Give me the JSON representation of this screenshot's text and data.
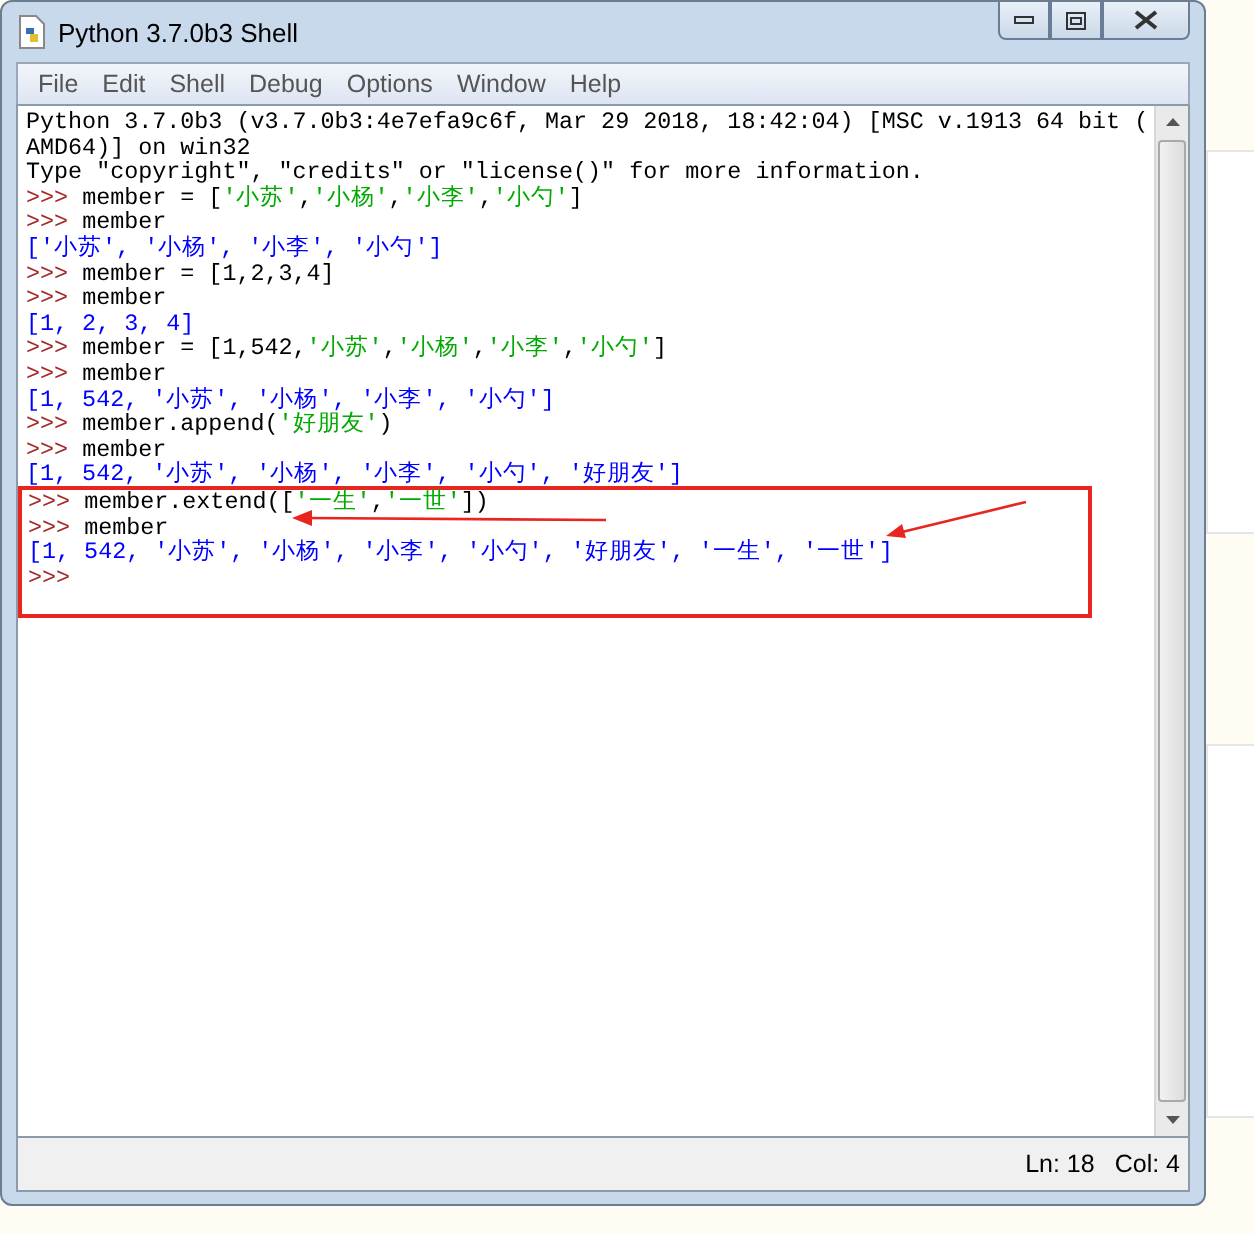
{
  "window": {
    "title": "Python 3.7.0b3 Shell"
  },
  "menu": [
    "File",
    "Edit",
    "Shell",
    "Debug",
    "Options",
    "Window",
    "Help"
  ],
  "lines": [
    {
      "boxed": false,
      "segments": [
        {
          "kind": "output_plain",
          "text": "Python 3.7.0b3 (v3.7.0b3:4e7efa9c6f, Mar 29 2018, 18:42:04) [MSC v.1913 64 bit ("
        }
      ]
    },
    {
      "boxed": false,
      "segments": [
        {
          "kind": "output_plain",
          "text": "AMD64)] on win32"
        }
      ]
    },
    {
      "boxed": false,
      "segments": [
        {
          "kind": "output_plain",
          "text": "Type \"copyright\", \"credits\" or \"license()\" for more information."
        }
      ]
    },
    {
      "boxed": false,
      "segments": [
        {
          "kind": "prompt",
          "text": ">>> "
        },
        {
          "kind": "code",
          "text": "member = ["
        },
        {
          "kind": "string",
          "text": "'小苏'"
        },
        {
          "kind": "code",
          "text": ","
        },
        {
          "kind": "string",
          "text": "'小杨'"
        },
        {
          "kind": "code",
          "text": ","
        },
        {
          "kind": "string",
          "text": "'小李'"
        },
        {
          "kind": "code",
          "text": ","
        },
        {
          "kind": "string",
          "text": "'小勺'"
        },
        {
          "kind": "code",
          "text": "]"
        }
      ]
    },
    {
      "boxed": false,
      "segments": [
        {
          "kind": "prompt",
          "text": ">>> "
        },
        {
          "kind": "code",
          "text": "member"
        }
      ]
    },
    {
      "boxed": false,
      "segments": [
        {
          "kind": "result",
          "text": "['小苏', '小杨', '小李', '小勺']"
        }
      ]
    },
    {
      "boxed": false,
      "segments": [
        {
          "kind": "prompt",
          "text": ">>> "
        },
        {
          "kind": "code",
          "text": "member = [1,2,3,4]"
        }
      ]
    },
    {
      "boxed": false,
      "segments": [
        {
          "kind": "prompt",
          "text": ">>> "
        },
        {
          "kind": "code",
          "text": "member"
        }
      ]
    },
    {
      "boxed": false,
      "segments": [
        {
          "kind": "result",
          "text": "[1, 2, 3, 4]"
        }
      ]
    },
    {
      "boxed": false,
      "segments": [
        {
          "kind": "prompt",
          "text": ">>> "
        },
        {
          "kind": "code",
          "text": "member = [1,542,"
        },
        {
          "kind": "string",
          "text": "'小苏'"
        },
        {
          "kind": "code",
          "text": ","
        },
        {
          "kind": "string",
          "text": "'小杨'"
        },
        {
          "kind": "code",
          "text": ","
        },
        {
          "kind": "string",
          "text": "'小李'"
        },
        {
          "kind": "code",
          "text": ","
        },
        {
          "kind": "string",
          "text": "'小勺'"
        },
        {
          "kind": "code",
          "text": "]"
        }
      ]
    },
    {
      "boxed": false,
      "segments": [
        {
          "kind": "prompt",
          "text": ">>> "
        },
        {
          "kind": "code",
          "text": "member"
        }
      ]
    },
    {
      "boxed": false,
      "segments": [
        {
          "kind": "result",
          "text": "[1, 542, '小苏', '小杨', '小李', '小勺']"
        }
      ]
    },
    {
      "boxed": false,
      "segments": [
        {
          "kind": "prompt",
          "text": ">>> "
        },
        {
          "kind": "code",
          "text": "member.append("
        },
        {
          "kind": "string",
          "text": "'好朋友'"
        },
        {
          "kind": "code",
          "text": ")"
        }
      ]
    },
    {
      "boxed": false,
      "segments": [
        {
          "kind": "prompt",
          "text": ">>> "
        },
        {
          "kind": "code",
          "text": "member"
        }
      ]
    },
    {
      "boxed": false,
      "segments": [
        {
          "kind": "result",
          "text": "[1, 542, '小苏', '小杨', '小李', '小勺', '好朋友']"
        }
      ]
    },
    {
      "boxed": true,
      "segments": [
        {
          "kind": "prompt",
          "text": ">>> "
        },
        {
          "kind": "code",
          "text": "member.extend(["
        },
        {
          "kind": "string",
          "text": "'一生'"
        },
        {
          "kind": "code",
          "text": ","
        },
        {
          "kind": "string",
          "text": "'一世'"
        },
        {
          "kind": "code",
          "text": "])"
        }
      ]
    },
    {
      "boxed": true,
      "segments": [
        {
          "kind": "prompt",
          "text": ">>> "
        },
        {
          "kind": "code",
          "text": "member"
        }
      ]
    },
    {
      "boxed": true,
      "segments": [
        {
          "kind": "result",
          "text": "[1, 542, '小苏', '小杨', '小李', '小勺', '好朋友', '一生', '一世']"
        }
      ]
    },
    {
      "boxed": true,
      "segments": [
        {
          "kind": "prompt",
          "text": ">>>"
        }
      ]
    }
  ],
  "status_bar": {
    "line": "Ln: 18",
    "column": "Col: 4"
  }
}
